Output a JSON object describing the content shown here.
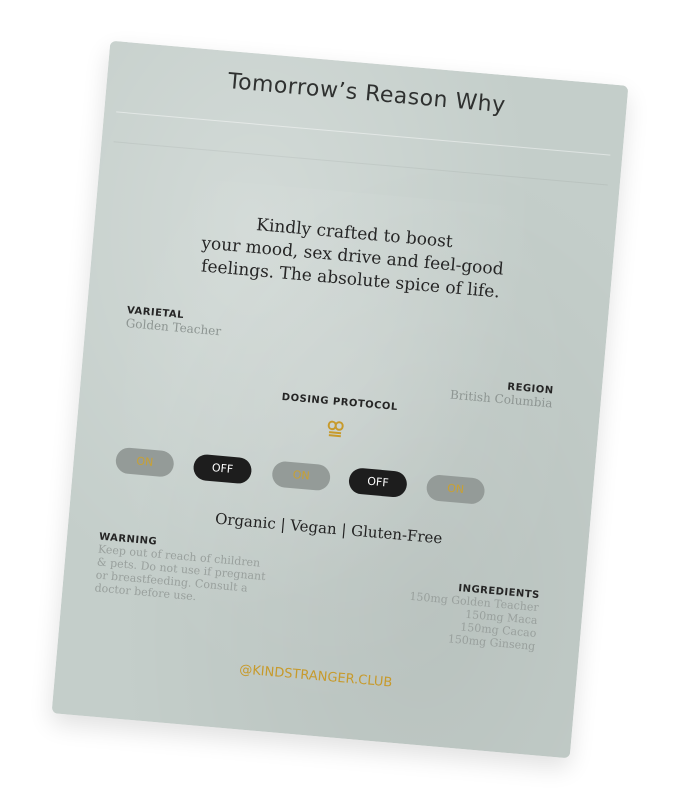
{
  "product": {
    "brand_name": "Tomorrow’s Reason Why",
    "tagline": [
      "Kindly crafted to boost",
      "your mood, sex drive and feel-good",
      "feelings. The absolute spice of life."
    ]
  },
  "varietal": {
    "label": "VARIETAL",
    "value": "Golden Teacher"
  },
  "region": {
    "label": "REGION",
    "value": "British Columbia"
  },
  "dosing_protocol": {
    "label": "DOSING PROTOCOL",
    "icon": "gold-knot-logo-icon",
    "schedule": [
      "ON",
      "OFF",
      "ON",
      "OFF",
      "ON"
    ]
  },
  "features": "Organic | Vegan | Gluten-Free",
  "warning": {
    "label": "WARNING",
    "text": "Keep out of reach of children & pets. Do not use if pregnant or breastfeeding. Consult a doctor before use."
  },
  "ingredients": {
    "label": "INGREDIENTS",
    "items": [
      "150mg Golden Teacher",
      "150mg Maca",
      "150mg Cacao",
      "150mg Ginseng"
    ]
  },
  "handle": "@KINDSTRANGER.CLUB",
  "colors": {
    "pouch": "#c4ceca",
    "accent_gold": "#c79a2b",
    "on_pill": "#949b98",
    "off_pill": "#1d1d1d"
  }
}
